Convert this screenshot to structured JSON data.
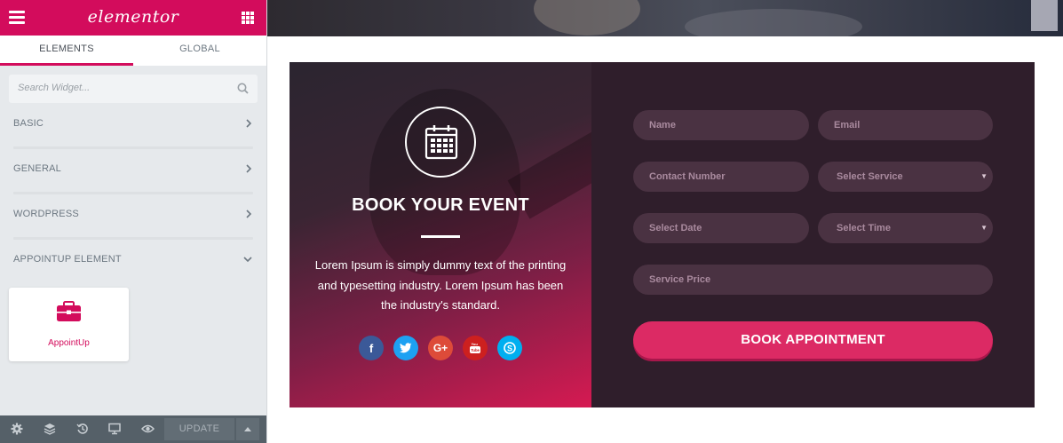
{
  "editor": {
    "brand": "elementor",
    "tabs": [
      "ELEMENTS",
      "GLOBAL"
    ],
    "search_placeholder": "Search Widget...",
    "categories": [
      "BASIC",
      "GENERAL",
      "WORDPRESS",
      "APPOINTUP ELEMENT"
    ],
    "widget_label": "AppointUp",
    "update_label": "UPDATE",
    "accent_color": "#d30c5c",
    "footer_icons": [
      "settings-icon",
      "layers-icon",
      "history-icon",
      "responsive-icon",
      "preview-icon"
    ]
  },
  "booking": {
    "title": "BOOK YOUR EVENT",
    "description": "Lorem Ipsum is simply dummy text of the printing and typesetting industry. Lorem Ipsum has been the industry's standard.",
    "social": [
      "f",
      "t",
      "G+",
      "yt",
      "S"
    ],
    "fields": {
      "name": "Name",
      "email": "Email",
      "contact": "Contact Number",
      "service": "Select Service",
      "date": "Select Date",
      "time": "Select Time",
      "price": "Service Price"
    },
    "button": "BOOK APPOINTMENT",
    "button_color": "#dc2a64"
  }
}
